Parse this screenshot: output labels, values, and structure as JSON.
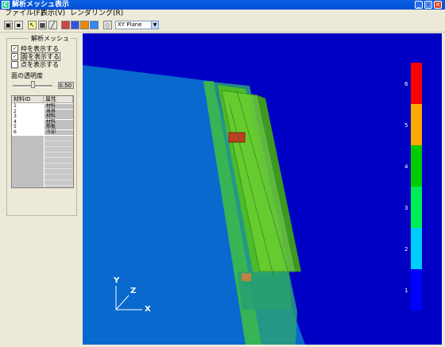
{
  "window": {
    "title": "解析メッシュ表示"
  },
  "menu": {
    "file": "ファイル(F)",
    "view": "表示(V)",
    "render": "レンダリング(R)"
  },
  "toolbar": {
    "plane_select": "XY Plane"
  },
  "panel": {
    "group_title": "解析メッシュ",
    "show_frame": "枠を表示する",
    "show_face": "面を表示する",
    "show_point": "点を表示する",
    "transparency_label": "面の透明度",
    "transparency_value": "0.50",
    "table": {
      "headers": [
        "材料ID",
        "属性"
      ],
      "rows": [
        {
          "id": "1",
          "attr": "材料"
        },
        {
          "id": "2",
          "attr": "境界"
        },
        {
          "id": "3",
          "attr": "材料"
        },
        {
          "id": "4",
          "attr": "材料"
        },
        {
          "id": "5",
          "attr": "筋板"
        },
        {
          "id": "6",
          "attr": "冷却"
        }
      ]
    }
  },
  "legend": {
    "labels": [
      "6",
      "5",
      "4",
      "3",
      "2",
      "1"
    ],
    "colors": [
      "#ff0000",
      "#ffaa00",
      "#00cc00",
      "#00ee55",
      "#00ccff",
      "#0000ff"
    ]
  },
  "axes": {
    "x": "X",
    "y": "Y",
    "z": "Z"
  }
}
